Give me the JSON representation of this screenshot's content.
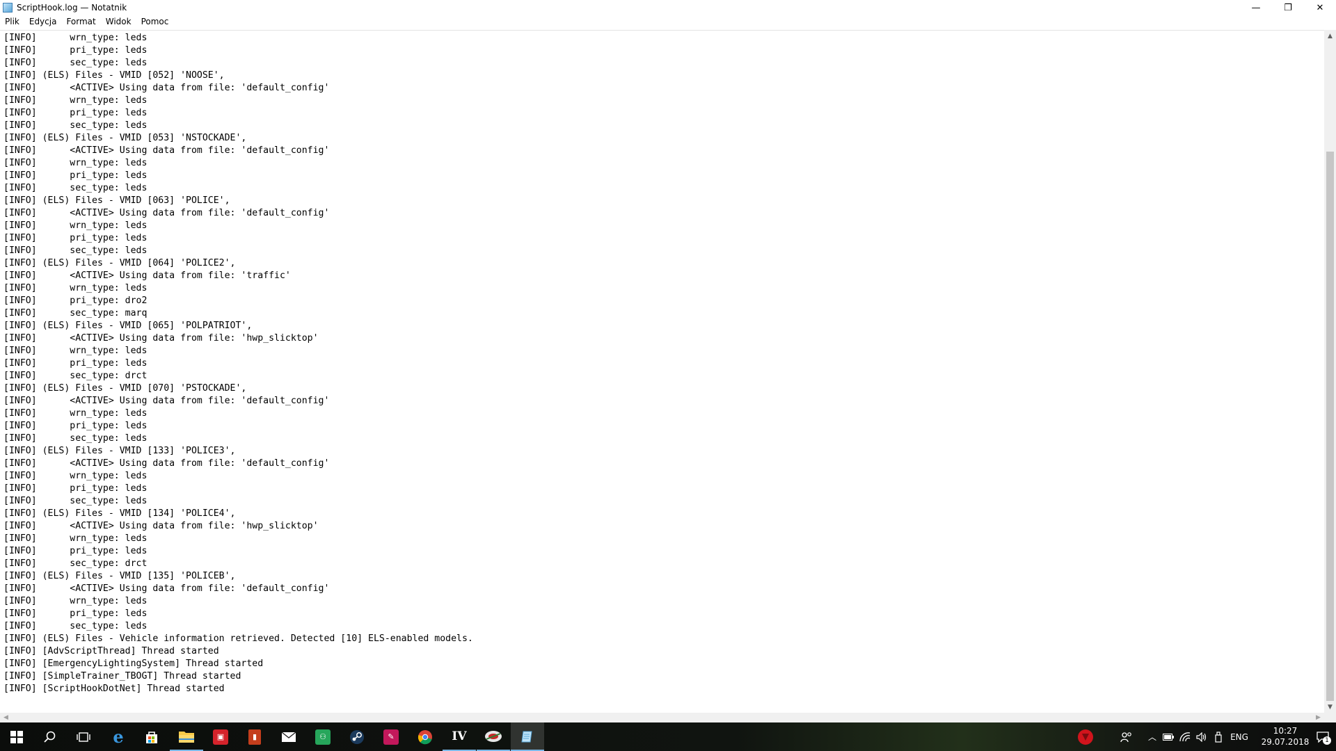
{
  "window": {
    "title": "ScriptHook.log — Notatnik",
    "controls": {
      "minimize": "—",
      "maximize": "❐",
      "close": "✕"
    }
  },
  "menu": [
    "Plik",
    "Edycja",
    "Format",
    "Widok",
    "Pomoc"
  ],
  "log_lines": [
    "[INFO]      wrn_type: leds",
    "[INFO]      pri_type: leds",
    "[INFO]      sec_type: leds",
    "[INFO] (ELS) Files - VMID [052] 'NOOSE',",
    "[INFO]      <ACTIVE> Using data from file: 'default_config'",
    "[INFO]      wrn_type: leds",
    "[INFO]      pri_type: leds",
    "[INFO]      sec_type: leds",
    "[INFO] (ELS) Files - VMID [053] 'NSTOCKADE',",
    "[INFO]      <ACTIVE> Using data from file: 'default_config'",
    "[INFO]      wrn_type: leds",
    "[INFO]      pri_type: leds",
    "[INFO]      sec_type: leds",
    "[INFO] (ELS) Files - VMID [063] 'POLICE',",
    "[INFO]      <ACTIVE> Using data from file: 'default_config'",
    "[INFO]      wrn_type: leds",
    "[INFO]      pri_type: leds",
    "[INFO]      sec_type: leds",
    "[INFO] (ELS) Files - VMID [064] 'POLICE2',",
    "[INFO]      <ACTIVE> Using data from file: 'traffic'",
    "[INFO]      wrn_type: leds",
    "[INFO]      pri_type: dro2",
    "[INFO]      sec_type: marq",
    "[INFO] (ELS) Files - VMID [065] 'POLPATRIOT',",
    "[INFO]      <ACTIVE> Using data from file: 'hwp_slicktop'",
    "[INFO]      wrn_type: leds",
    "[INFO]      pri_type: leds",
    "[INFO]      sec_type: drct",
    "[INFO] (ELS) Files - VMID [070] 'PSTOCKADE',",
    "[INFO]      <ACTIVE> Using data from file: 'default_config'",
    "[INFO]      wrn_type: leds",
    "[INFO]      pri_type: leds",
    "[INFO]      sec_type: leds",
    "[INFO] (ELS) Files - VMID [133] 'POLICE3',",
    "[INFO]      <ACTIVE> Using data from file: 'default_config'",
    "[INFO]      wrn_type: leds",
    "[INFO]      pri_type: leds",
    "[INFO]      sec_type: leds",
    "[INFO] (ELS) Files - VMID [134] 'POLICE4',",
    "[INFO]      <ACTIVE> Using data from file: 'hwp_slicktop'",
    "[INFO]      wrn_type: leds",
    "[INFO]      pri_type: leds",
    "[INFO]      sec_type: drct",
    "[INFO] (ELS) Files - VMID [135] 'POLICEB',",
    "[INFO]      <ACTIVE> Using data from file: 'default_config'",
    "[INFO]      wrn_type: leds",
    "[INFO]      pri_type: leds",
    "[INFO]      sec_type: leds",
    "[INFO] (ELS) Files - Vehicle information retrieved. Detected [10] ELS-enabled models.",
    "[INFO] [AdvScriptThread] Thread started",
    "[INFO] [EmergencyLightingSystem] Thread started",
    "[INFO] [SimpleTrainer_TBOGT] Thread started",
    "[INFO] [ScriptHookDotNet] Thread started"
  ],
  "taskbar": {
    "apps": [
      {
        "icon": "windows-start-icon"
      },
      {
        "icon": "search-icon"
      },
      {
        "icon": "task-view-icon"
      },
      {
        "icon": "edge-browser-icon"
      },
      {
        "icon": "store-icon"
      },
      {
        "icon": "file-explorer-icon"
      },
      {
        "icon": "red-app-icon"
      },
      {
        "icon": "office-app-icon"
      },
      {
        "icon": "mail-icon"
      },
      {
        "icon": "gaming-app-icon"
      },
      {
        "icon": "steam-icon"
      },
      {
        "icon": "pink-app-icon"
      },
      {
        "icon": "chrome-icon"
      },
      {
        "icon": "iv-game-icon"
      },
      {
        "icon": "mod-tool-icon"
      },
      {
        "icon": "notepad-icon"
      }
    ],
    "tray": {
      "language": "ENG",
      "time": "10:27",
      "date": "29.07.2018",
      "notification_count": "1"
    }
  },
  "colors": {
    "taskbar_accent": "#79b8e8",
    "tray_red": "#d0141c"
  }
}
